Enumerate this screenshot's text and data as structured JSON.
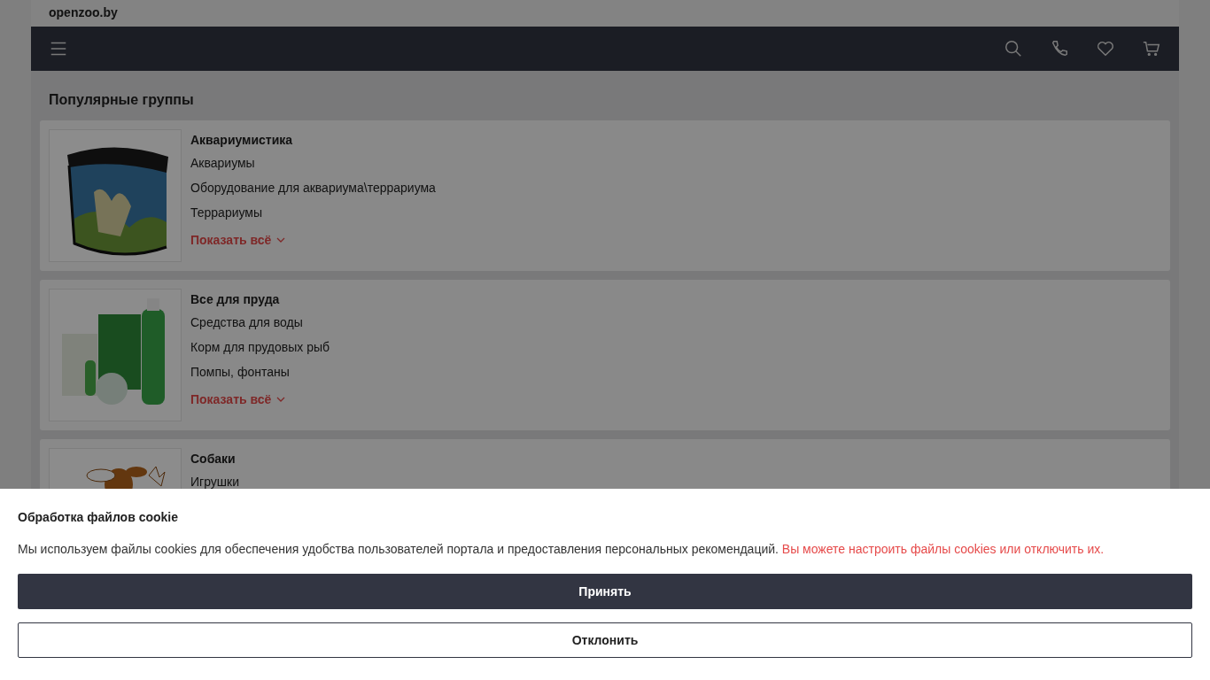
{
  "site": {
    "title": "openzoo.by"
  },
  "section": {
    "title": "Популярные группы"
  },
  "groups": [
    {
      "title": "Аквариумистика",
      "links": [
        "Аквариумы",
        "Оборудование для аквариума\\террариума",
        "Террариумы"
      ],
      "more": "Показать всё"
    },
    {
      "title": "Все для пруда",
      "links": [
        "Средства для воды",
        "Корм для прудовых рыб",
        "Помпы, фонтаны"
      ],
      "more": "Показать всё"
    },
    {
      "title": "Собаки",
      "links": [
        "Игрушки"
      ]
    }
  ],
  "cookie": {
    "title": "Обработка файлов cookie",
    "text": "Мы используем файлы cookies для обеспечения удобства пользователей портала и предоставления персональных рекомендаций.",
    "link": "Вы можете настроить файлы cookies или отключить их.",
    "accept": "Принять",
    "decline": "Отклонить"
  }
}
